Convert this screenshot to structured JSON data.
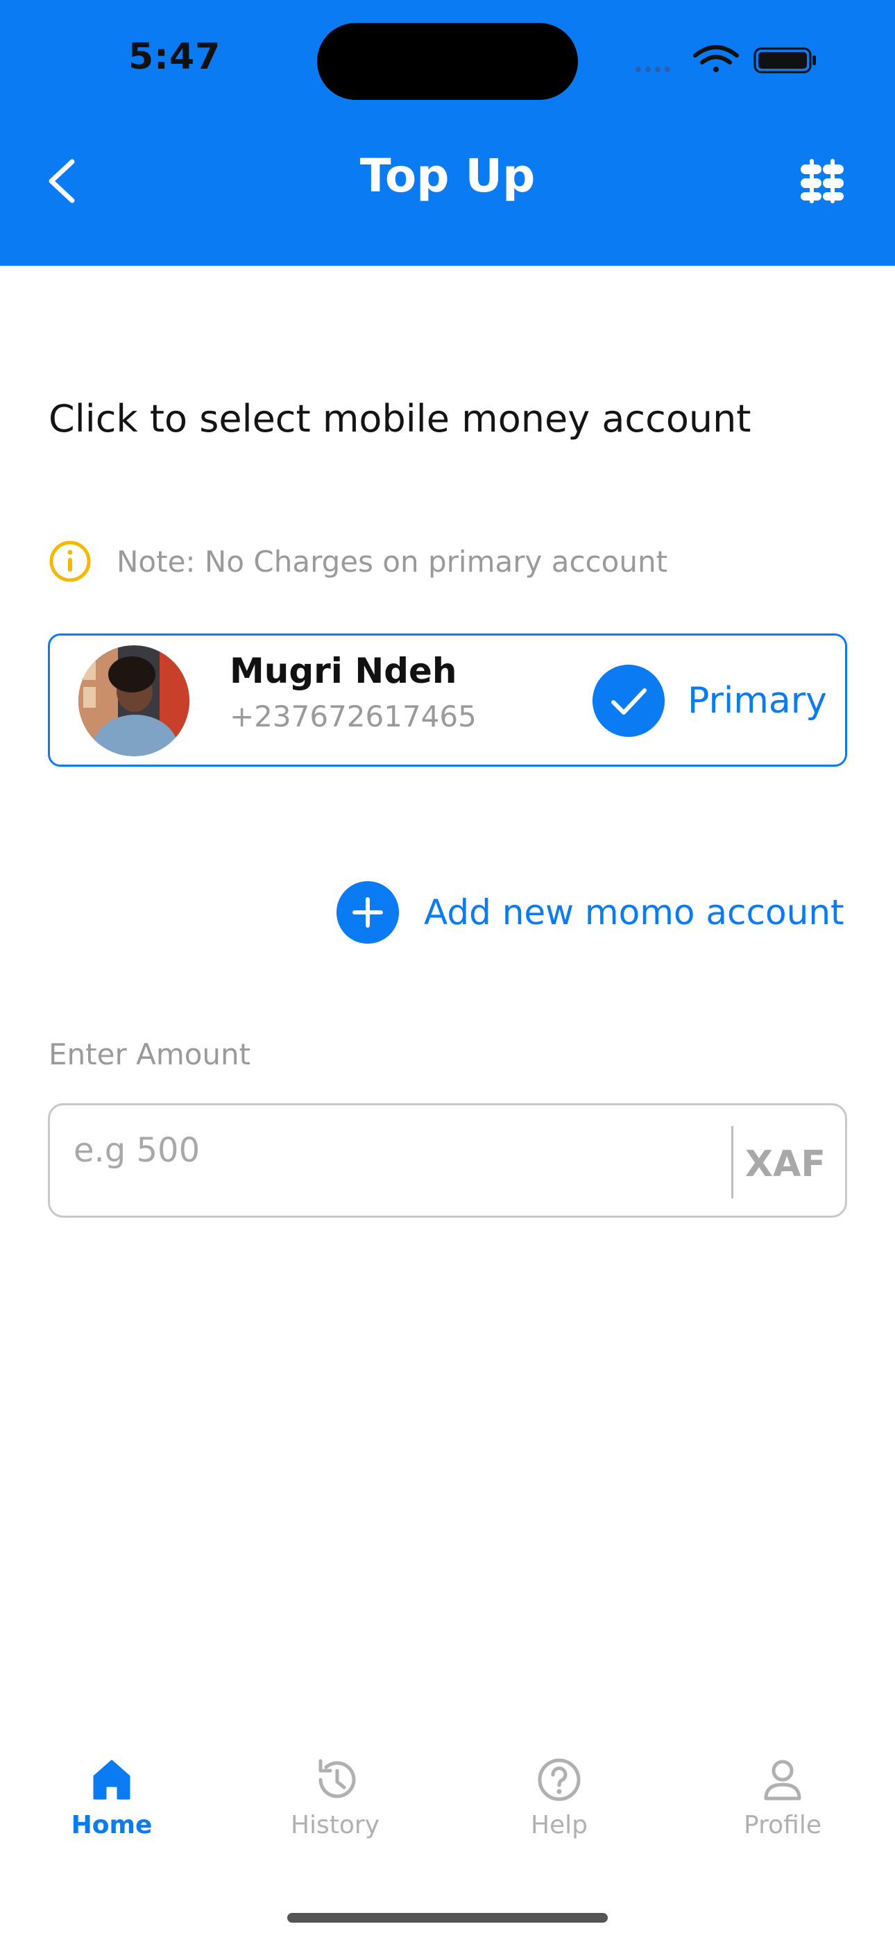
{
  "status_bar": {
    "time": "5:47"
  },
  "header": {
    "title": "Top Up"
  },
  "prompt": "Click to select mobile money account",
  "note": "Note: No Charges on primary account",
  "account": {
    "name": "Mugri Ndeh",
    "phone": "+237672617465",
    "badge": "Primary"
  },
  "add_account": {
    "label": "Add new momo account"
  },
  "amount": {
    "label": "Enter Amount",
    "placeholder": "e.g 500",
    "currency": "XAF"
  },
  "tabs": [
    {
      "label": "Home"
    },
    {
      "label": "History"
    },
    {
      "label": "Help"
    },
    {
      "label": "Profile"
    }
  ],
  "colors": {
    "accent": "#0a7bf2",
    "note_icon": "#f5b800",
    "muted": "#9a9a9a"
  }
}
